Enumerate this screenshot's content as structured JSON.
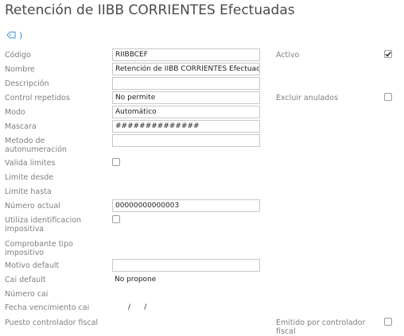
{
  "page": {
    "title": "Retención de IIBB CORRIENTES Efectuadas",
    "tag_arrow": ")"
  },
  "colors": {
    "accent": "#3b8fd6",
    "label": "#7f7f7f",
    "title": "#4a4a4a"
  },
  "icons": {
    "tag": "tag-icon",
    "arrow": "arrow-icon"
  },
  "fields": {
    "codigo": {
      "label": "Código",
      "value": "RIIBBCEF"
    },
    "nombre": {
      "label": "Nombre",
      "value": "Retención de IIBB CORRIENTES Efectuadas"
    },
    "descripcion": {
      "label": "Descripción",
      "value": ""
    },
    "control_repetidos": {
      "label": "Control repetidos",
      "value": "No permite"
    },
    "modo": {
      "label": "Modo",
      "value": "Automático"
    },
    "mascara": {
      "label": "Mascara",
      "value": "##############"
    },
    "metodo_autonumeracion": {
      "label": "Metodo de autonumeración",
      "value": ""
    },
    "valida_limites": {
      "label": "Valida limites",
      "checked": false
    },
    "limite_desde": {
      "label": "Limite desde"
    },
    "limite_hasta": {
      "label": "Limite hasta"
    },
    "numero_actual": {
      "label": "Número actual",
      "value": "00000000000003"
    },
    "utiliza_identificacion": {
      "label": "Utiliza identificacion impositiva",
      "checked": false
    },
    "comprobante_tipo": {
      "label": "Comprobante tipo impositivo"
    },
    "motivo_default": {
      "label": "Motivo default",
      "value": ""
    },
    "cai_default": {
      "label": "Cai default",
      "value": "No propone"
    },
    "numero_cai": {
      "label": "Número cai"
    },
    "fecha_vencimiento_cai": {
      "label": "Fecha vencimiento cai",
      "value": "/      /"
    },
    "puesto_controlador": {
      "label": "Puesto controlador fiscal"
    }
  },
  "right": {
    "activo": {
      "label": "Activo",
      "checked": true
    },
    "excluir_anulados": {
      "label": "Excluir anulados",
      "checked": false
    },
    "emitido_controlador": {
      "label": "Emitido por controlador fiscal",
      "checked": false
    }
  }
}
